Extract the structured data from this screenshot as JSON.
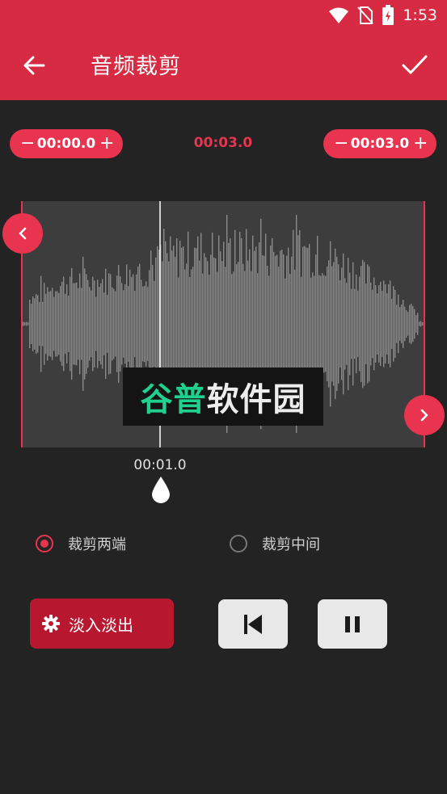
{
  "status": {
    "time": "1:53"
  },
  "app_bar": {
    "title": "音频裁剪"
  },
  "trim": {
    "start_time": "00:00.0",
    "duration": "00:03.0",
    "end_time": "00:03.0",
    "minus_glyph": "−",
    "plus_glyph": "+"
  },
  "playhead": {
    "time": "00:01.0"
  },
  "watermark": {
    "part1": "谷普",
    "part2": "软件园"
  },
  "options": [
    {
      "label": "裁剪两端",
      "selected": true
    },
    {
      "label": "裁剪中间",
      "selected": false
    }
  ],
  "controls": {
    "fade_label": "淡入淡出"
  },
  "colors": {
    "accent": "#e8344f",
    "app_bar": "#d62b42",
    "background": "#232323",
    "waveform": "#8a8a8a"
  }
}
